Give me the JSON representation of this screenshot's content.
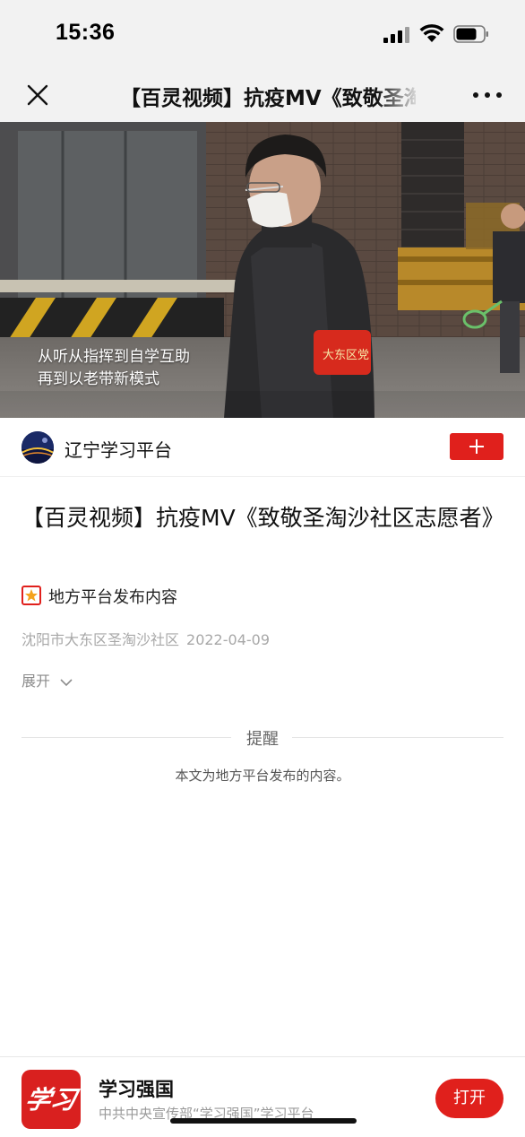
{
  "status_bar": {
    "time": "15:36"
  },
  "nav": {
    "title": "【百灵视频】抗疫MV《致敬圣淘沙社区志愿者》"
  },
  "video": {
    "caption_line1": "从听从指挥到自学互助",
    "caption_line2": "再到以老带新模式",
    "armband_text": "大东区党"
  },
  "channel": {
    "name": "辽宁学习平台"
  },
  "article": {
    "title": "【百灵视频】抗疫MV《致敬圣淘沙社区志愿者》",
    "source_label": "地方平台发布内容",
    "location": "沈阳市大东区圣淘沙社区",
    "date": "2022-04-09",
    "expand_label": "展开"
  },
  "reminder": {
    "title": "提醒",
    "text": "本文为地方平台发布的内容。"
  },
  "app_banner": {
    "logo_text": "学习",
    "name": "学习强国",
    "description": "中共中央宣传部“学习强国”学习平台",
    "open_label": "打开"
  },
  "colors": {
    "accent_red": "#e0201c",
    "nav_background": "#f2f2f2",
    "meta_gray": "#a8a8a8"
  }
}
